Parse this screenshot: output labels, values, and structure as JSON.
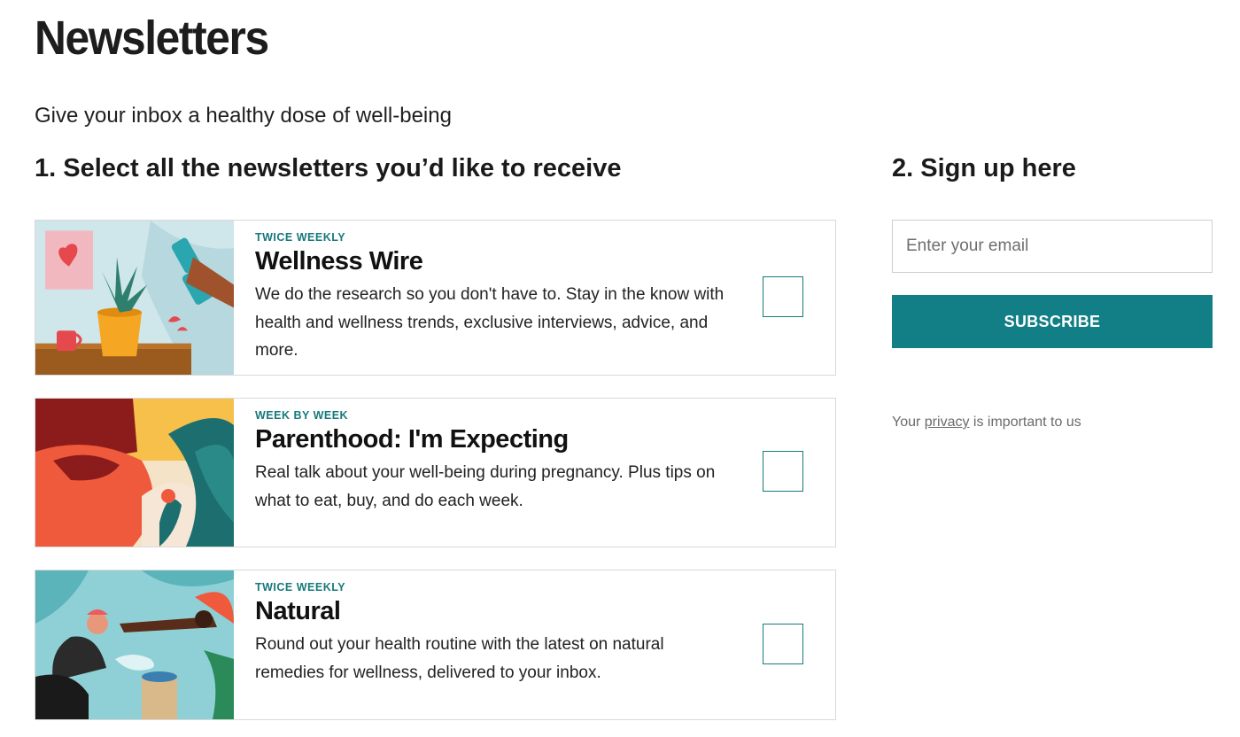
{
  "page": {
    "title": "Newsletters",
    "subtitle": "Give your inbox a healthy dose of well-being"
  },
  "steps": {
    "select_heading": "1. Select all the newsletters you’d like to receive",
    "signup_heading": "2. Sign up here"
  },
  "newsletters": [
    {
      "frequency": "TWICE WEEKLY",
      "name": "Wellness Wire",
      "description": "We do the research so you don't have to. Stay in the know with health and wellness trends, exclusive interviews, advice, and more.",
      "checked": false
    },
    {
      "frequency": "WEEK BY WEEK",
      "name": "Parenthood: I'm Expecting",
      "description": "Real talk about your well-being during pregnancy. Plus tips on what to eat, buy, and do each week.",
      "checked": false
    },
    {
      "frequency": "TWICE WEEKLY",
      "name": "Natural",
      "description": "Round out your health routine with the latest on natural remedies for wellness, delivered to your inbox.",
      "checked": false
    }
  ],
  "signup": {
    "email_placeholder": "Enter your email",
    "email_value": "",
    "subscribe_label": "SUBSCRIBE",
    "privacy_prefix": "Your ",
    "privacy_link": "privacy",
    "privacy_suffix": " is important to us"
  },
  "colors": {
    "accent": "#117f85",
    "frequency_text": "#17797c",
    "card_border": "#d9d9d9"
  },
  "icons": {
    "newsletter_1": "wellness-illustration",
    "newsletter_2": "pregnancy-illustration",
    "newsletter_3": "natural-remedies-illustration"
  }
}
